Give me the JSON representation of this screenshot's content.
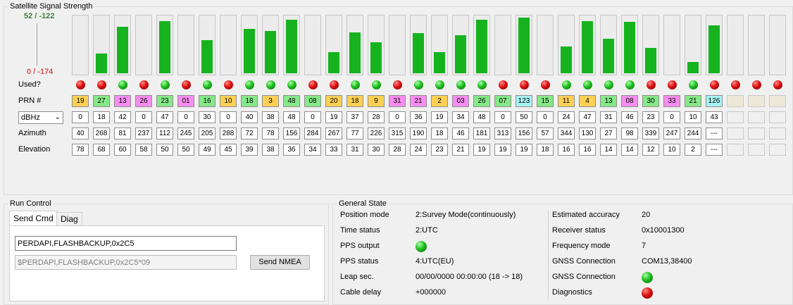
{
  "signal_panel": {
    "title": "Satellite Signal Strength",
    "scale_max": "52 / -122",
    "scale_min": "0 / -174",
    "labels": {
      "used": "Used?",
      "prn": "PRN #",
      "azimuth": "Azimuth",
      "elevation": "Elevation"
    },
    "unit_select": "dBHz",
    "signal_max": 52
  },
  "prn_colors": {
    "gps": "#fdd054",
    "glonass": "#86e888",
    "galileo": "#f78df0",
    "sbas": "#a5f3f4"
  },
  "satellites": [
    {
      "prn": "19",
      "kind": "gps",
      "used": false,
      "snr": "0",
      "az": "40",
      "el": "78"
    },
    {
      "prn": "27",
      "kind": "glonass",
      "used": false,
      "snr": "18",
      "az": "268",
      "el": "68"
    },
    {
      "prn": "13",
      "kind": "galileo",
      "used": true,
      "snr": "42",
      "az": "81",
      "el": "60"
    },
    {
      "prn": "26",
      "kind": "galileo",
      "used": false,
      "snr": "0",
      "az": "237",
      "el": "58"
    },
    {
      "prn": "23",
      "kind": "glonass",
      "used": true,
      "snr": "47",
      "az": "112",
      "el": "50"
    },
    {
      "prn": "01",
      "kind": "galileo",
      "used": false,
      "snr": "0",
      "az": "245",
      "el": "50"
    },
    {
      "prn": "16",
      "kind": "glonass",
      "used": true,
      "snr": "30",
      "az": "205",
      "el": "49"
    },
    {
      "prn": "10",
      "kind": "gps",
      "used": false,
      "snr": "0",
      "az": "288",
      "el": "45"
    },
    {
      "prn": "18",
      "kind": "glonass",
      "used": true,
      "snr": "40",
      "az": "72",
      "el": "39"
    },
    {
      "prn": "3",
      "kind": "gps",
      "used": true,
      "snr": "38",
      "az": "78",
      "el": "38"
    },
    {
      "prn": "48",
      "kind": "glonass",
      "used": true,
      "snr": "48",
      "az": "156",
      "el": "36"
    },
    {
      "prn": "08",
      "kind": "glonass",
      "used": false,
      "snr": "0",
      "az": "284",
      "el": "34"
    },
    {
      "prn": "20",
      "kind": "gps",
      "used": false,
      "snr": "19",
      "az": "267",
      "el": "33"
    },
    {
      "prn": "18",
      "kind": "gps",
      "used": true,
      "snr": "37",
      "az": "77",
      "el": "31"
    },
    {
      "prn": "9",
      "kind": "gps",
      "used": true,
      "snr": "28",
      "az": "226",
      "el": "30"
    },
    {
      "prn": "31",
      "kind": "galileo",
      "used": false,
      "snr": "0",
      "az": "315",
      "el": "28"
    },
    {
      "prn": "21",
      "kind": "galileo",
      "used": true,
      "snr": "36",
      "az": "190",
      "el": "24"
    },
    {
      "prn": "2",
      "kind": "gps",
      "used": true,
      "snr": "19",
      "az": "18",
      "el": "23"
    },
    {
      "prn": "03",
      "kind": "galileo",
      "used": true,
      "snr": "34",
      "az": "46",
      "el": "21"
    },
    {
      "prn": "26",
      "kind": "glonass",
      "used": true,
      "snr": "48",
      "az": "181",
      "el": "19"
    },
    {
      "prn": "07",
      "kind": "glonass",
      "used": false,
      "snr": "0",
      "az": "313",
      "el": "19"
    },
    {
      "prn": "123",
      "kind": "sbas",
      "used": false,
      "snr": "50",
      "az": "156",
      "el": "19"
    },
    {
      "prn": "15",
      "kind": "glonass",
      "used": false,
      "snr": "0",
      "az": "57",
      "el": "18"
    },
    {
      "prn": "11",
      "kind": "gps",
      "used": true,
      "snr": "24",
      "az": "344",
      "el": "16"
    },
    {
      "prn": "4",
      "kind": "gps",
      "used": true,
      "snr": "47",
      "az": "130",
      "el": "16"
    },
    {
      "prn": "13",
      "kind": "glonass",
      "used": true,
      "snr": "31",
      "az": "27",
      "el": "14"
    },
    {
      "prn": "08",
      "kind": "galileo",
      "used": true,
      "snr": "46",
      "az": "98",
      "el": "14"
    },
    {
      "prn": "30",
      "kind": "glonass",
      "used": false,
      "snr": "23",
      "az": "339",
      "el": "12"
    },
    {
      "prn": "33",
      "kind": "galileo",
      "used": false,
      "snr": "0",
      "az": "247",
      "el": "10"
    },
    {
      "prn": "21",
      "kind": "glonass",
      "used": true,
      "snr": "10",
      "az": "244",
      "el": "2"
    },
    {
      "prn": "126",
      "kind": "sbas",
      "used": false,
      "snr": "43",
      "az": "---",
      "el": "---"
    },
    {
      "prn": "",
      "kind": "empty",
      "used": false,
      "snr": "",
      "az": "",
      "el": ""
    },
    {
      "prn": "",
      "kind": "empty",
      "used": false,
      "snr": "",
      "az": "",
      "el": ""
    },
    {
      "prn": "",
      "kind": "empty",
      "used": false,
      "snr": "",
      "az": "",
      "el": ""
    }
  ],
  "run_control": {
    "title": "Run Control",
    "tabs": [
      "Send Cmd",
      "Diag"
    ],
    "active_tab": "Send Cmd",
    "command_value": "PERDAPI,FLASHBACKUP,0x2C5",
    "nmea_value": "$PERDAPI,FLASHBACKUP,0x2C5*09",
    "send_button": "Send NMEA"
  },
  "general_state": {
    "title": "General State",
    "left": [
      {
        "label": "Position mode",
        "value": "2:Survey Mode(continuously)"
      },
      {
        "label": "Time status",
        "value": "2:UTC"
      },
      {
        "label": "PPS output",
        "value": "",
        "led": "green"
      },
      {
        "label": "PPS status",
        "value": "4:UTC(EU)"
      },
      {
        "label": "Leap sec.",
        "value": "00/00/0000 00:00:00 (18 -> 18)"
      },
      {
        "label": "Cable delay",
        "value": "+000000"
      }
    ],
    "right": [
      {
        "label": "Estimated accuracy",
        "value": "20"
      },
      {
        "label": "Receiver status",
        "value": "0x10001300"
      },
      {
        "label": "Frequency mode",
        "value": "7"
      },
      {
        "label": "GNSS Connection",
        "value": "COM13,38400"
      },
      {
        "label": "GNSS Connection",
        "value": "",
        "led": "green"
      },
      {
        "label": "Diagnostics",
        "value": "",
        "led": "red"
      }
    ]
  }
}
